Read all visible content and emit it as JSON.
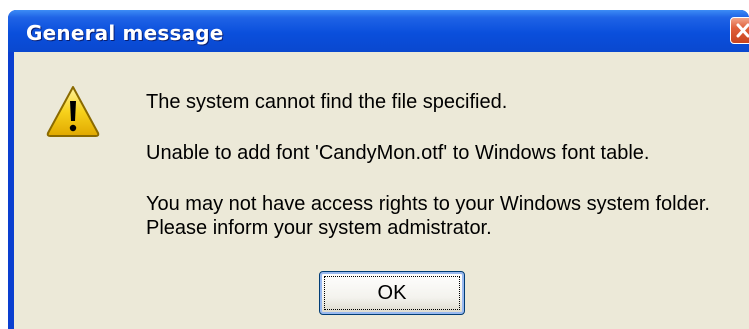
{
  "window": {
    "title": "General message",
    "close_icon": "close-icon"
  },
  "dialog": {
    "icon": "warning-icon",
    "line1": "The system cannot find the file specified.",
    "line2": "Unable to add font 'CandyMon.otf' to Windows font table.",
    "line3": "You may not have access rights to your Windows system folder.",
    "line4": "Please inform your system admistrator.",
    "ok_label": "OK"
  },
  "colors": {
    "titlebar": "#0a4fdc",
    "client": "#ece9d8",
    "close_button": "#e0603a",
    "warning": "#f7d21c"
  }
}
